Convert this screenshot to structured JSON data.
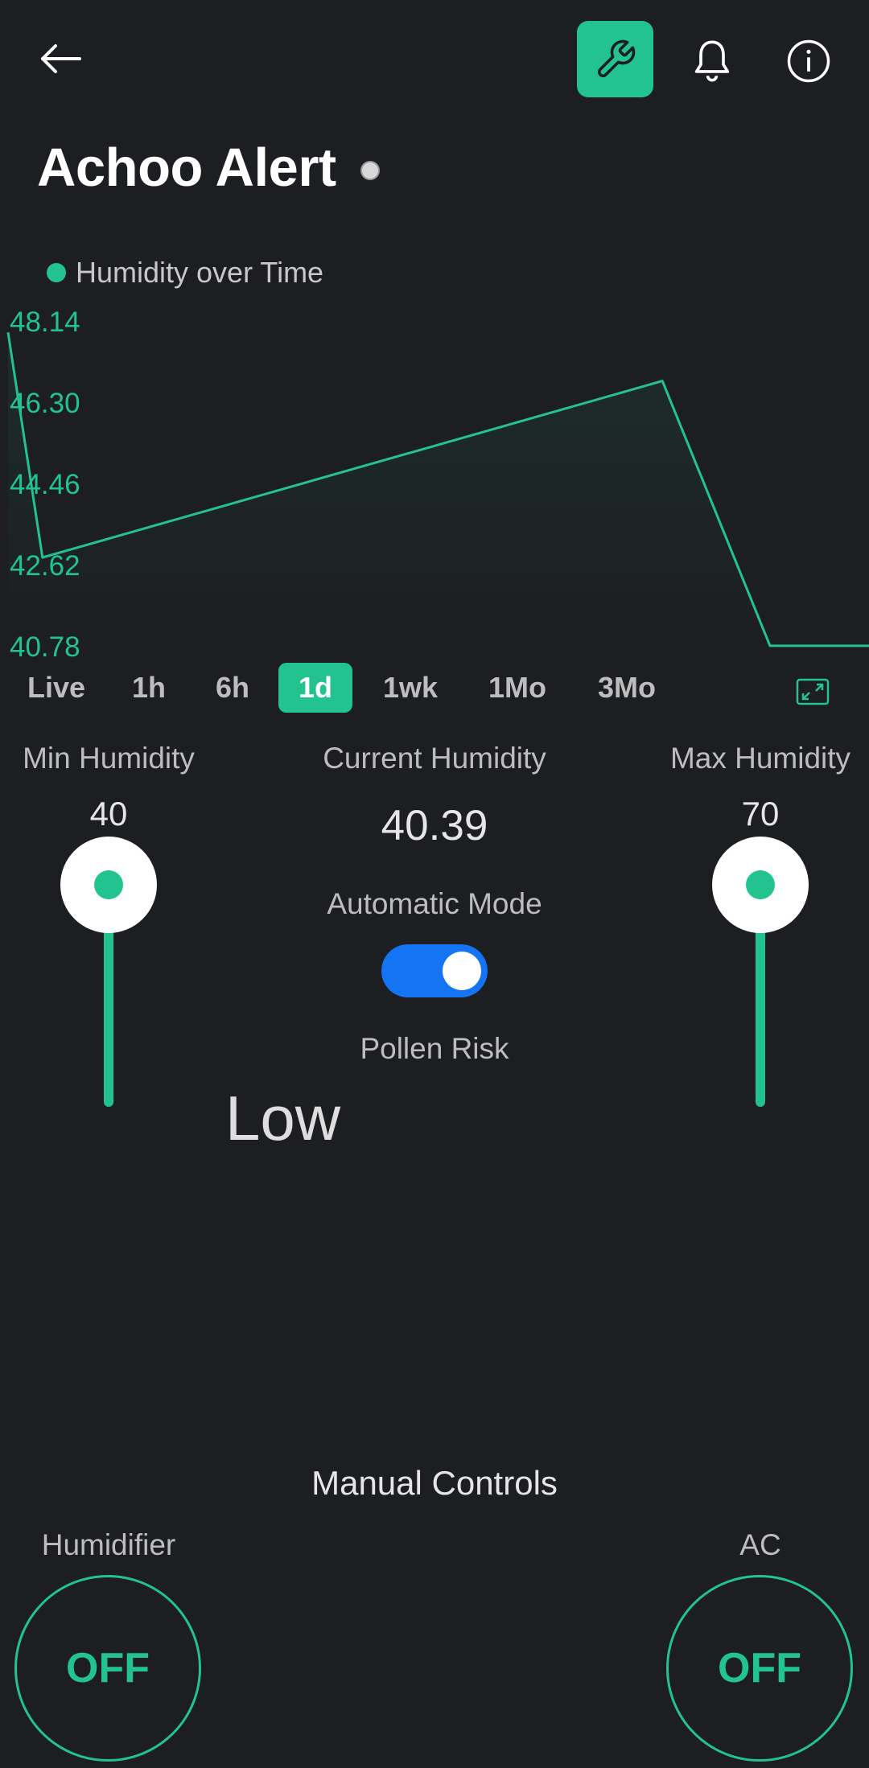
{
  "header": {
    "back_icon": "arrow-left-icon",
    "tools_icon": "wrench-icon",
    "notifications_icon": "bell-icon",
    "info_icon": "info-icon",
    "accent": "#22c38e"
  },
  "title": "Achoo Alert",
  "chart_data": {
    "type": "area",
    "legend": "Humidity over Time",
    "y_ticks": [
      "48.14",
      "46.30",
      "44.46",
      "42.62",
      "40.78"
    ],
    "ylim": [
      40.78,
      48.14
    ],
    "points": [
      {
        "x": 0.0,
        "y": 47.9
      },
      {
        "x": 0.04,
        "y": 42.8
      },
      {
        "x": 0.76,
        "y": 46.8
      },
      {
        "x": 0.885,
        "y": 40.8
      },
      {
        "x": 1.0,
        "y": 40.8
      }
    ],
    "color": "#22c38e",
    "grid": false
  },
  "time_ranges": [
    "Live",
    "1h",
    "6h",
    "1d",
    "1wk",
    "1Mo",
    "3Mo"
  ],
  "active_range": "1d",
  "expand_icon": "expand-icon",
  "min_humidity": {
    "label": "Min Humidity",
    "value": "40"
  },
  "current_humidity": {
    "label": "Current Humidity",
    "value": "40.39"
  },
  "max_humidity": {
    "label": "Max Humidity",
    "value": "70"
  },
  "automatic_mode": {
    "label": "Automatic Mode",
    "on": true
  },
  "pollen": {
    "label": "Pollen Risk",
    "value": "Low"
  },
  "manual": {
    "title": "Manual Controls",
    "humidifier": {
      "label": "Humidifier",
      "state": "OFF"
    },
    "ac": {
      "label": "AC",
      "state": "OFF"
    }
  }
}
